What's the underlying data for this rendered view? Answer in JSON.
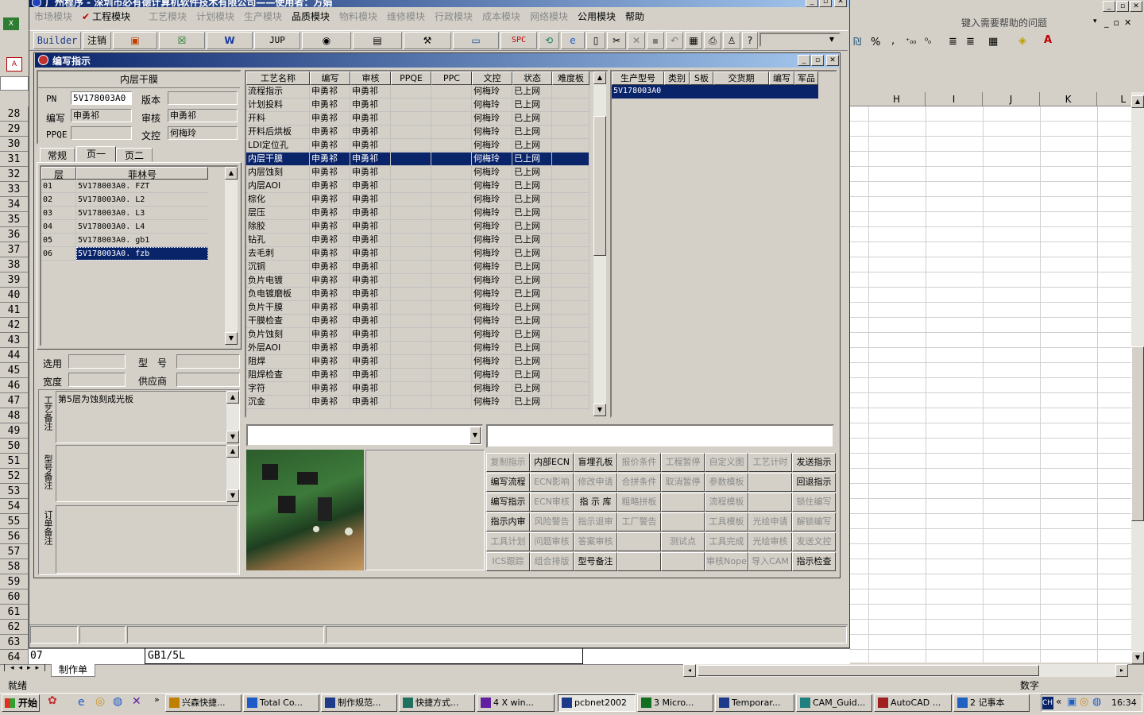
{
  "window_title": "广州程序 - 深圳市必有德计算机软件技术有限公司——使用者：方娟",
  "menu": [
    "市场模块",
    "工程模块",
    "工艺模块",
    "计划模块",
    "生产模块",
    "品质模块",
    "物料模块",
    "维修模块",
    "行政模块",
    "成本模块",
    "网络模块",
    "公用模块",
    "帮助"
  ],
  "menu_enabled": [
    "工程模块",
    "品质模块",
    "公用模块",
    "帮助"
  ],
  "toolbar": {
    "builder": "Builder",
    "logout": "注销",
    "jup": "JUP",
    "spc": "SPC"
  },
  "excel": {
    "help_placeholder": "键入需要帮助的问题",
    "columns": [
      "H",
      "I",
      "J",
      "K",
      "L"
    ],
    "rows": [
      "28",
      "29",
      "30",
      "31",
      "32",
      "33",
      "34",
      "35",
      "36",
      "37",
      "38",
      "39",
      "40",
      "41",
      "42",
      "43",
      "44",
      "45",
      "46",
      "47",
      "48",
      "49",
      "50",
      "51",
      "52",
      "53",
      "54",
      "55",
      "56",
      "57",
      "58",
      "59",
      "60",
      "61",
      "62",
      "63",
      "64"
    ],
    "row64_a": "07",
    "row64_b": "GB1/5L",
    "sheet_tab": "制作单",
    "status": "就绪",
    "num": "数字"
  },
  "dialog": {
    "title": "编写指示",
    "process_title": "内层干膜",
    "pn_label": "PN",
    "pn_value": "5V178003A0",
    "version_label": "版本",
    "version_value": "",
    "writer_label": "编写",
    "writer_value": "申勇祁",
    "reviewer_label": "审核",
    "reviewer_value": "申勇祁",
    "ppqe_label": "PPQE",
    "ppqe_value": "",
    "doc_label": "文控",
    "doc_value": "何梅玲",
    "tabs": [
      "常规",
      "页一",
      "页二"
    ],
    "layer_headers": [
      "层",
      "菲林号"
    ],
    "layers": [
      {
        "layer": "01",
        "film": "5V178003A0. FZT"
      },
      {
        "layer": "02",
        "film": "5V178003A0. L2"
      },
      {
        "layer": "03",
        "film": "5V178003A0. L3"
      },
      {
        "layer": "04",
        "film": "5V178003A0. L4"
      },
      {
        "layer": "05",
        "film": "5V178003A0. gb1"
      },
      {
        "layer": "06",
        "film": "5V178003A0. fzb"
      }
    ],
    "select_label": "选用",
    "model_label": "型　号",
    "width_label": "宽度",
    "supplier_label": "供应商",
    "remark_labels": [
      "工艺备注",
      "型号备注",
      "订单备注"
    ],
    "process_remark": "第5层为蚀刻成光板",
    "process_headers": [
      "工艺名称",
      "编写",
      "审核",
      "PPQE",
      "PPC",
      "文控",
      "状态",
      "难度板"
    ],
    "processes": [
      "流程指示",
      "计划投料",
      "开料",
      "开料后烘板",
      "LDI定位孔",
      "内层干膜",
      "内层蚀刻",
      "内层AOI",
      "棕化",
      "层压",
      "除胶",
      "钻孔",
      "去毛刺",
      "沉铜",
      "负片电镀",
      "负电镀磨板",
      "负片干膜",
      "干膜检查",
      "负片蚀刻",
      "外层AOI",
      "阻焊",
      "阻焊检查",
      "字符",
      "沉金"
    ],
    "proc_writer": "申勇祁",
    "proc_reviewer": "申勇祁",
    "proc_doc": "何梅玲",
    "proc_status": "已上网",
    "selected_process_index": 5,
    "order_headers": [
      "生产型号",
      "类别",
      "S板",
      "交货期",
      "编写",
      "军品"
    ],
    "order_row": "5V178003A0",
    "action_buttons": [
      [
        "复制指示",
        "内部ECN",
        "盲埋孔板",
        "报价条件",
        "工程暂停",
        "自定义图",
        "工艺计时",
        "发送指示"
      ],
      [
        "编写流程",
        "ECN影响",
        "修改申请",
        "合拼条件",
        "取消暂停",
        "参数模板",
        "",
        "回退指示"
      ],
      [
        "编写指示",
        "ECN审核",
        "指 示 库",
        "粗略拼板",
        "",
        "流程模板",
        "",
        "锁住编写"
      ],
      [
        "指示内审",
        "风险警告",
        "指示退审",
        "工厂警告",
        "",
        "工具模板",
        "光绘申请",
        "解锁编写"
      ],
      [
        "工具计划",
        "问题审核",
        "答案审核",
        "",
        "测试点",
        "工具完成",
        "光绘审核",
        "发送文控"
      ],
      [
        "ICS跟踪",
        "组合排版",
        "型号备注",
        "",
        "",
        "审核Nope",
        "导入CAM",
        "指示检查"
      ]
    ],
    "action_enabled": [
      "内部ECN",
      "盲埋孔板",
      "发送指示",
      "编写流程",
      "回退指示",
      "编写指示",
      "指 示 库",
      "指示内审",
      "型号备注",
      "指示检查"
    ]
  },
  "taskbar": {
    "start": "开始",
    "items": [
      "兴森快捷...",
      "Total Co...",
      "制作规范...",
      "快捷方式...",
      "4 X win...",
      "pcbnet2002",
      "3 Micro...",
      "Temporar...",
      "CAM_Guid...",
      "AutoCAD ...",
      "2 记事本"
    ],
    "tray_ch": "CH",
    "clock": "16:34"
  }
}
